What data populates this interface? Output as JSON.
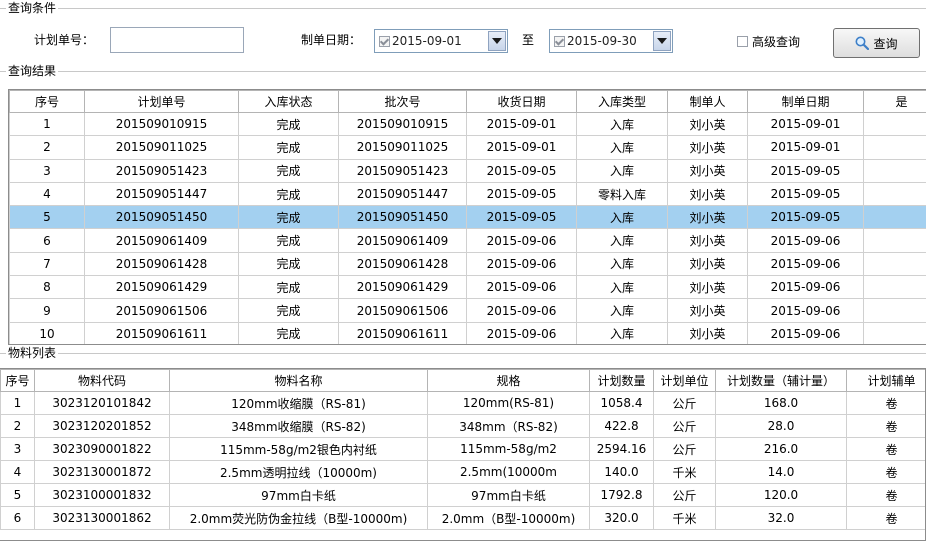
{
  "query_section": {
    "title": "查询条件",
    "plan_no_label": "计划单号：",
    "plan_no_value": "",
    "date_label": "制单日期：",
    "date_from": "2015-09-01",
    "to_label": "至",
    "date_to": "2015-09-30",
    "advanced_label": "高级查询",
    "advanced_checked": false,
    "query_button": "查询"
  },
  "results_section": {
    "title": "查询结果",
    "columns": [
      "序号",
      "计划单号",
      "入库状态",
      "批次号",
      "收货日期",
      "入库类型",
      "制单人",
      "制单日期",
      "是"
    ],
    "selected_index": 4,
    "rows": [
      [
        "1",
        "201509010915",
        "完成",
        "201509010915",
        "2015-09-01",
        "入库",
        "刘小英",
        "2015-09-01"
      ],
      [
        "2",
        "201509011025",
        "完成",
        "201509011025",
        "2015-09-01",
        "入库",
        "刘小英",
        "2015-09-01"
      ],
      [
        "3",
        "201509051423",
        "完成",
        "201509051423",
        "2015-09-05",
        "入库",
        "刘小英",
        "2015-09-05"
      ],
      [
        "4",
        "201509051447",
        "完成",
        "201509051447",
        "2015-09-05",
        "零料入库",
        "刘小英",
        "2015-09-05"
      ],
      [
        "5",
        "201509051450",
        "完成",
        "201509051450",
        "2015-09-05",
        "入库",
        "刘小英",
        "2015-09-05"
      ],
      [
        "6",
        "201509061409",
        "完成",
        "201509061409",
        "2015-09-06",
        "入库",
        "刘小英",
        "2015-09-06"
      ],
      [
        "7",
        "201509061428",
        "完成",
        "201509061428",
        "2015-09-06",
        "入库",
        "刘小英",
        "2015-09-06"
      ],
      [
        "8",
        "201509061429",
        "完成",
        "201509061429",
        "2015-09-06",
        "入库",
        "刘小英",
        "2015-09-06"
      ],
      [
        "9",
        "201509061506",
        "完成",
        "201509061506",
        "2015-09-06",
        "入库",
        "刘小英",
        "2015-09-06"
      ],
      [
        "10",
        "201509061611",
        "完成",
        "201509061611",
        "2015-09-06",
        "入库",
        "刘小英",
        "2015-09-06"
      ]
    ]
  },
  "materials_section": {
    "title": "物料列表",
    "columns": [
      "序号",
      "物料代码",
      "物料名称",
      "规格",
      "计划数量",
      "计划单位",
      "计划数量（辅计量）",
      "计划辅单"
    ],
    "rows": [
      [
        "1",
        "3023120101842",
        "120mm收缩膜（RS-81)",
        "120mm(RS-81)",
        "1058.4",
        "公斤",
        "168.0",
        "卷"
      ],
      [
        "2",
        "3023120201852",
        "348mm收缩膜（RS-82)",
        "348mm（RS-82)",
        "422.8",
        "公斤",
        "28.0",
        "卷"
      ],
      [
        "3",
        "3023090001822",
        "115mm-58g/m2银色内衬纸",
        "115mm-58g/m2",
        "2594.16",
        "公斤",
        "216.0",
        "卷"
      ],
      [
        "4",
        "3023130001872",
        "2.5mm透明拉线（10000m)",
        "2.5mm(10000m",
        "140.0",
        "千米",
        "14.0",
        "卷"
      ],
      [
        "5",
        "3023100001832",
        "97mm白卡纸",
        "97mm白卡纸",
        "1792.8",
        "公斤",
        "120.0",
        "卷"
      ],
      [
        "6",
        "3023130001862",
        "2.0mm荧光防伪金拉线（B型-10000m)",
        "2.0mm（B型-10000m)",
        "320.0",
        "千米",
        "32.0",
        "卷"
      ]
    ]
  },
  "colors": {
    "selected_row": "#a3d0f0",
    "grid_line": "#d0d0d0"
  },
  "icons": {
    "query_button_icon": "magnifier-icon",
    "dropdown_icon": "chevron-down-icon"
  }
}
